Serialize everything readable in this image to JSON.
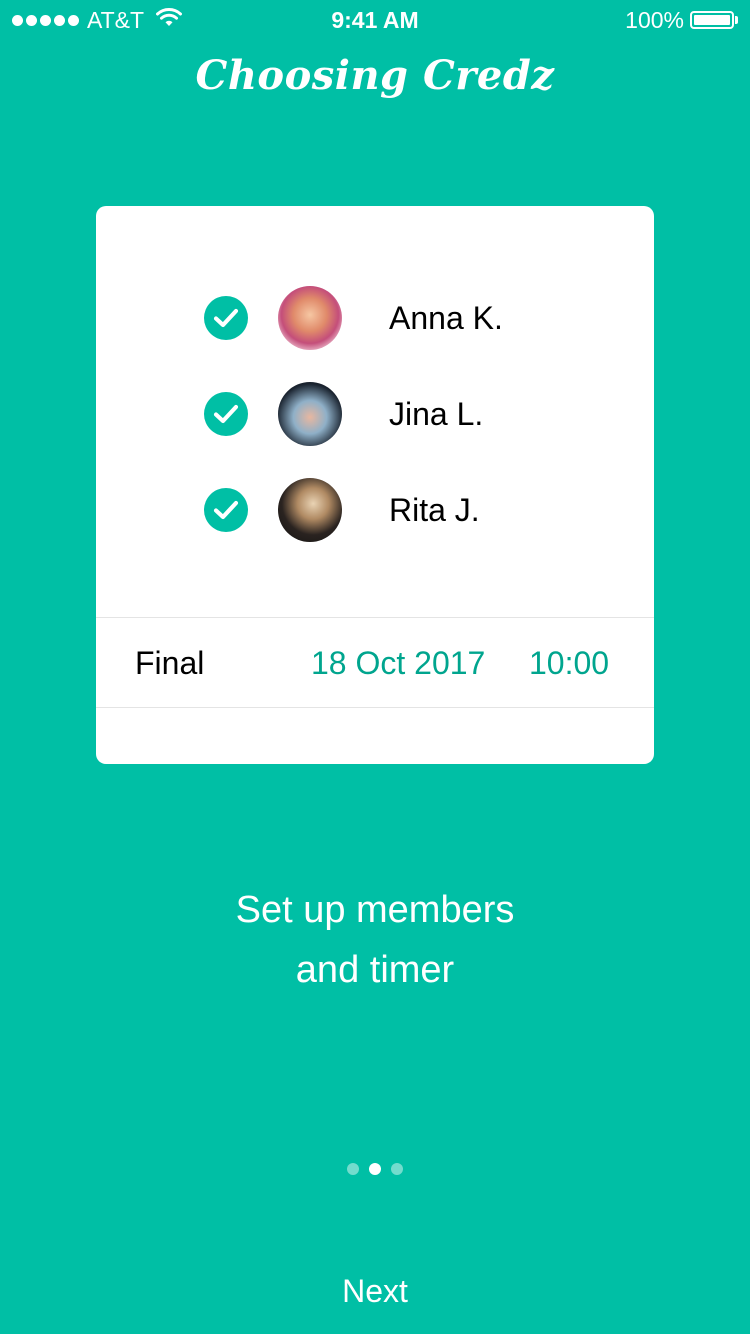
{
  "status_bar": {
    "carrier": "AT&T",
    "time": "9:41 AM",
    "battery": "100%"
  },
  "app": {
    "title": "Choosing Credz"
  },
  "card": {
    "members": [
      {
        "name": "Anna K.",
        "checked": true,
        "avatar": "avatar-photo"
      },
      {
        "name": "Jina L.",
        "checked": true,
        "avatar": "avatar-photo"
      },
      {
        "name": "Rita J.",
        "checked": true,
        "avatar": "avatar-photo"
      }
    ],
    "final": {
      "label": "Final",
      "date": "18 Oct 2017",
      "time": "10:00"
    }
  },
  "onboarding": {
    "line1": "Set up members",
    "line2": "and timer",
    "page_count": 3,
    "active_page": 2
  },
  "actions": {
    "next_label": "Next"
  },
  "colors": {
    "background": "#00BFA5",
    "accent_text": "#00A58E",
    "card": "#FFFFFF"
  }
}
